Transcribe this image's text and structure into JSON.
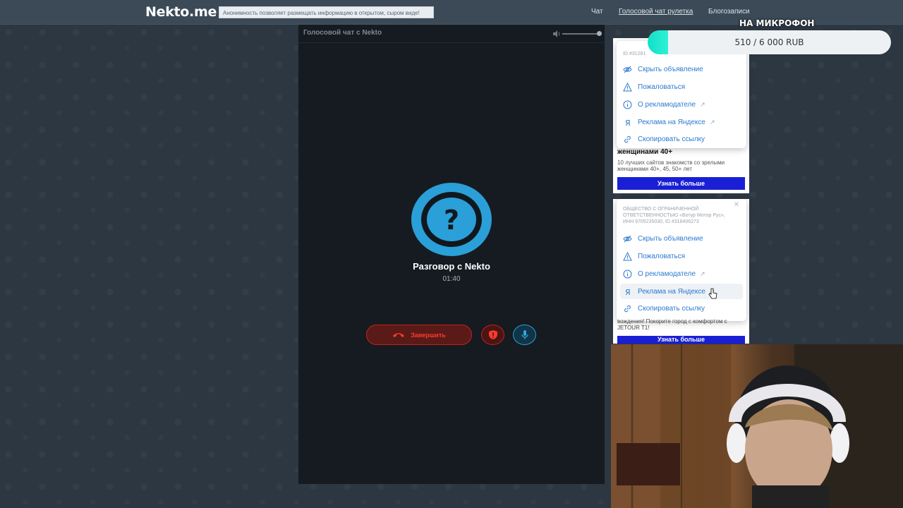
{
  "header": {
    "logo": "Nekto.me",
    "notice": "Анонимность позволяет размещать информацию в открытом, сыром виде!",
    "nav": [
      {
        "label": "Чат"
      },
      {
        "label": "Голосовой чат рулетка"
      },
      {
        "label": "Блогозаписи"
      }
    ]
  },
  "chat": {
    "title": "Голосовой чат с Nekto",
    "conversation_title": "Разговор с Nekto",
    "timer": "01:40",
    "end_label": "Завершить",
    "volume_level": 1.0
  },
  "ad1": {
    "id_text": "ID #31281",
    "menu": [
      {
        "label": "Скрыть объявление",
        "icon": "eye-slash-icon"
      },
      {
        "label": "Пожаловаться",
        "icon": "warning-icon"
      },
      {
        "label": "О рекламодателе",
        "icon": "info-icon",
        "external": true
      },
      {
        "label": "Реклама на Яндексе",
        "icon": "yandex-icon",
        "external": true
      },
      {
        "label": "Скопировать ссылку",
        "icon": "link-icon"
      }
    ],
    "title": "женщинами 40+",
    "text": "10 лучших сайтов знакомств со зрелыми женщинами 40+, 45, 50+ лет",
    "button": "Узнать больше"
  },
  "ad2": {
    "advertiser": "ОБЩЕСТВО С ОГРАНИЧЕННОЙ ОТВЕТСТВЕННОСТЬЮ «Вотур Мотор Рус», ИНН 9705235030, ID #318406273",
    "menu": [
      {
        "label": "Скрыть объявление",
        "icon": "eye-slash-icon"
      },
      {
        "label": "Пожаловаться",
        "icon": "warning-icon"
      },
      {
        "label": "О рекламодателе",
        "icon": "info-icon",
        "external": true
      },
      {
        "label": "Реклама на Яндексе",
        "icon": "yandex-icon",
        "external": true
      },
      {
        "label": "Скопировать ссылку",
        "icon": "link-icon"
      }
    ],
    "text": "вождения! Покорите город с комфортом с JETOUR T1!",
    "button": "Узнать больше"
  },
  "donation": {
    "label": "НА МИКРОФОН",
    "progress_text": "510 / 6 000 RUB",
    "progress_fraction": 0.085
  },
  "colors": {
    "accent_blue": "#2a9fd8",
    "danger_red": "#c2221c",
    "progress_teal": "#12e0c8",
    "ad_button": "#1a1fd6"
  }
}
